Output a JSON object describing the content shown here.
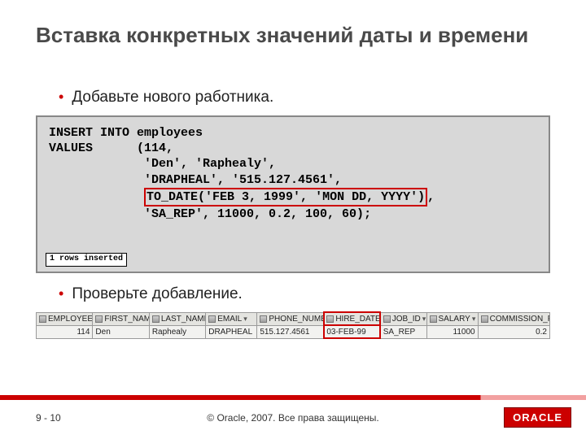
{
  "title": "Вставка конкретных значений даты и времени",
  "bullets": {
    "b1": "Добавьте нового работника.",
    "b2": "Проверьте добавление."
  },
  "code": {
    "l1": "INSERT INTO employees",
    "l2": "VALUES      (114,",
    "l3": "             'Den', 'Raphealy',",
    "l4": "             'DRAPHEAL', '515.127.4561',",
    "l5_indent": "             ",
    "l5_hl": "TO_DATE('FEB 3, 1999', 'MON DD, YYYY')",
    "l5_tail": ",",
    "l6": "             'SA_REP', 11000, 0.2, 100, 60);",
    "rows_badge": "1 rows inserted"
  },
  "table": {
    "headers": {
      "c0": "EMPLOYEE_ID",
      "c1": "FIRST_NAME",
      "c2": "LAST_NAME",
      "c3": "EMAIL",
      "c4": "PHONE_NUMBER",
      "c5": "HIRE_DATE",
      "c6": "JOB_ID",
      "c7": "SALARY",
      "c8": "COMMISSION_PCT"
    },
    "row": {
      "c0": "114",
      "c1": "Den",
      "c2": "Raphealy",
      "c3": "DRAPHEAL",
      "c4": "515.127.4561",
      "c5": "03-FEB-99",
      "c6": "SA_REP",
      "c7": "11000",
      "c8": "0.2"
    }
  },
  "footer": {
    "page": "9 - 10",
    "copyright": "© Oracle, 2007. Все права защищены.",
    "logo": "ORACLE"
  }
}
